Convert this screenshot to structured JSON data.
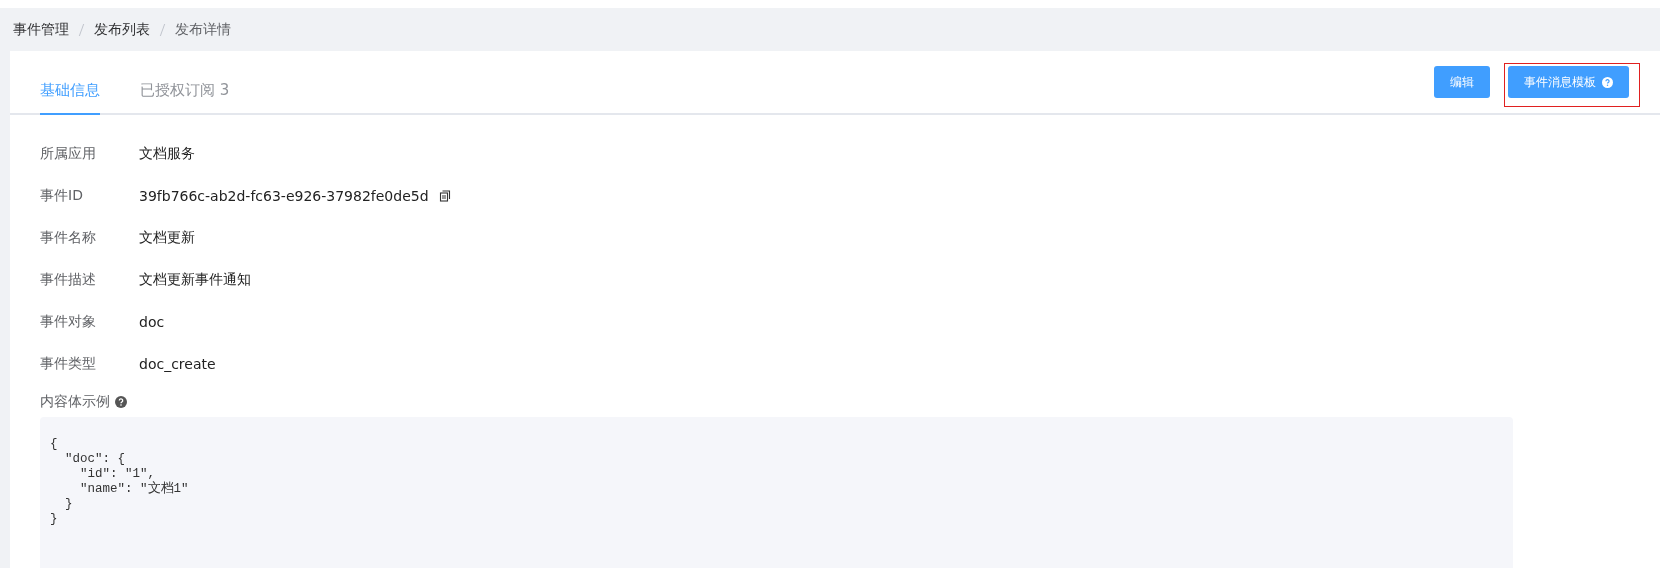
{
  "breadcrumb": [
    "事件管理",
    "发布列表",
    "发布详情"
  ],
  "tabs": [
    {
      "label": "基础信息",
      "selected": true
    },
    {
      "label": "已授权订阅 3",
      "selected": false
    }
  ],
  "buttons": [
    {
      "label": "编辑",
      "help": false,
      "highlighted": false
    },
    {
      "label": "事件消息模板",
      "help": true,
      "highlighted": true
    }
  ],
  "fields": [
    {
      "label": "所属应用",
      "value": "文档服务",
      "copyable": false
    },
    {
      "label": "事件ID",
      "value": "39fb766c-ab2d-fc63-e926-37982fe0de5d",
      "copyable": true
    },
    {
      "label": "事件名称",
      "value": "文档更新",
      "copyable": false
    },
    {
      "label": "事件描述",
      "value": "文档更新事件通知",
      "copyable": false
    },
    {
      "label": "事件对象",
      "value": "doc",
      "copyable": false
    },
    {
      "label": "事件类型",
      "value": "doc_create",
      "copyable": false
    }
  ],
  "example": {
    "label": "内容体示例",
    "help": true,
    "code": "{\n  \"doc\": {\n    \"id\": \"1\",\n    \"name\": \"文档1\"\n  }\n}"
  }
}
